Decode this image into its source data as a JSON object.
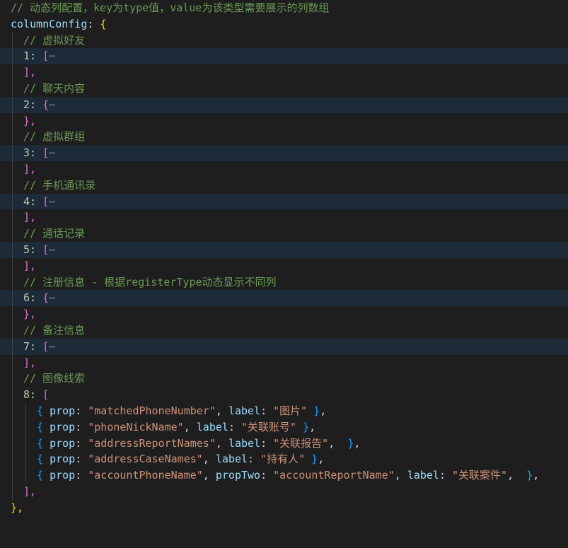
{
  "code": {
    "header_comment": "// 动态列配置，key为type值，value为该类型需要展示的列数组",
    "config_key": "columnConfig",
    "sections": [
      {
        "comment": "// 虚拟好友",
        "key": "1",
        "open": "[",
        "close": "],"
      },
      {
        "comment": "// 聊天内容",
        "key": "2",
        "open": "{",
        "close": "},"
      },
      {
        "comment": "// 虚拟群组",
        "key": "3",
        "open": "[",
        "close": "],"
      },
      {
        "comment": "// 手机通讯录",
        "key": "4",
        "open": "[",
        "close": "],"
      },
      {
        "comment": "// 通话记录",
        "key": "5",
        "open": "[",
        "close": "],"
      },
      {
        "comment": "// 注册信息 - 根据registerType动态显示不同列",
        "key": "6",
        "open": "{",
        "close": "},"
      },
      {
        "comment": "// 备注信息",
        "key": "7",
        "open": "[",
        "close": "],"
      }
    ],
    "folded_ellipsis": "⋯",
    "expanded": {
      "comment": "// 图像线索",
      "key": "8",
      "open": "[",
      "close": "],",
      "items": [
        {
          "prop": "\"matchedPhoneNumber\"",
          "label": "\"图片\""
        },
        {
          "prop": "\"phoneNickName\"",
          "label": "\"关联账号\""
        },
        {
          "prop": "\"addressReportNames\"",
          "label": "\"关联报告\""
        },
        {
          "prop": "\"addressCaseNames\"",
          "label": "\"持有人\""
        },
        {
          "prop": "\"accountPhoneName\"",
          "propTwo": "\"accountReportName\"",
          "label": "\"关联案件\""
        }
      ]
    },
    "final_close": "},"
  },
  "colors": {
    "background": "#1e1e1e",
    "comment": "#6a9955",
    "property": "#9cdcfe",
    "number": "#b5cea8",
    "string": "#ce9178",
    "bracket_level1": "#ffd700",
    "bracket_level2": "#da70d6",
    "bracket_level3": "#179fff",
    "folded_line_highlight": "#1d2a38"
  }
}
